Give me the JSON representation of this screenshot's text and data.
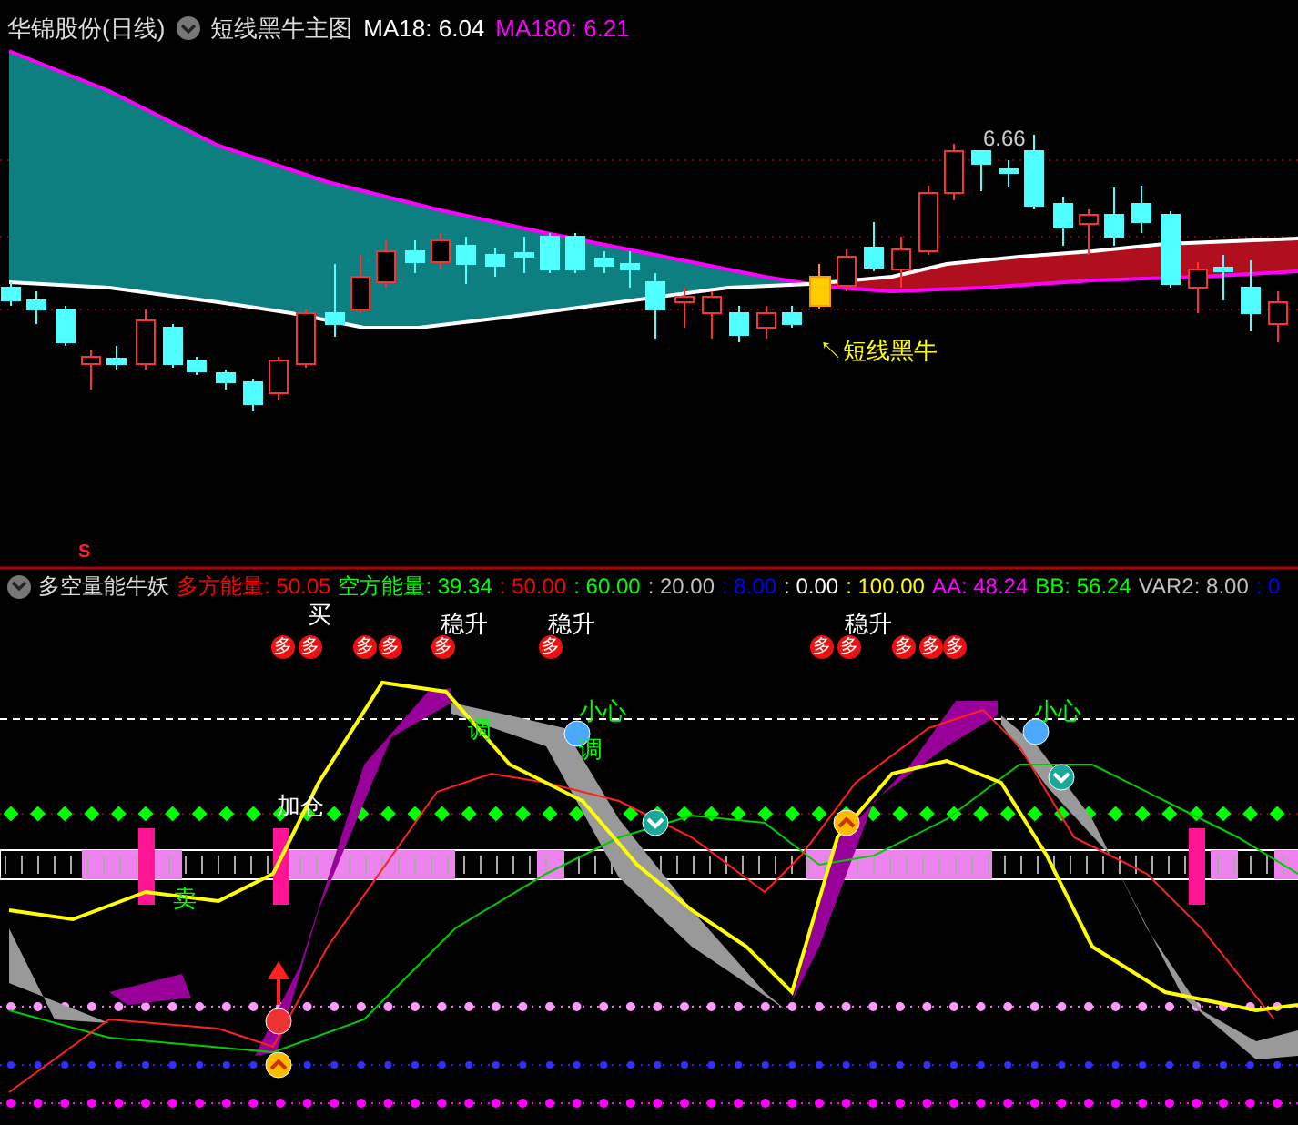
{
  "main_chart": {
    "stock": "华锦股份(日线)",
    "indicator": "短线黑牛主图",
    "readings": [
      {
        "text": "MA18: 6.04",
        "color": "#ffffff"
      },
      {
        "text": "MA180: 6.21",
        "color": "#ff00ff"
      }
    ],
    "peak_label": "6.66",
    "signal_label": "↖短线黑牛"
  },
  "sub_chart": {
    "marker": "S",
    "title": "多空量能牛妖",
    "readings": [
      {
        "text": "多方能量: 50.05",
        "color": "#ff0000"
      },
      {
        "text": "空方能量: 39.34",
        "color": "#00ff00"
      },
      {
        "text": ": 50.00",
        "color": "#ff0000"
      },
      {
        "text": ": 60.00",
        "color": "#00ff00"
      },
      {
        "text": ": 20.00",
        "color": "#c0c0c0"
      },
      {
        "text": ": 8.00",
        "color": "#0000ff"
      },
      {
        "text": ": 0.00",
        "color": "#ffffff"
      },
      {
        "text": ": 100.00",
        "color": "#ffff00"
      },
      {
        "text": "AA: 48.24",
        "color": "#ff00ff"
      },
      {
        "text": "BB: 56.24",
        "color": "#00ff00"
      },
      {
        "text": "VAR2: 8.00",
        "color": "#c0c0c0"
      },
      {
        "text": ": 0",
        "color": "#0000ff"
      }
    ],
    "badges": [
      "多",
      "多",
      "多",
      "多",
      "多",
      "多",
      "多",
      "多",
      "多",
      "多",
      "多"
    ],
    "labels": [
      {
        "text": "买",
        "color": "#ffffff"
      },
      {
        "text": "稳升",
        "color": "#ffffff"
      },
      {
        "text": "稳升",
        "color": "#ffffff"
      },
      {
        "text": "稳升",
        "color": "#ffffff"
      },
      {
        "text": "小心",
        "color": "#00ff00"
      },
      {
        "text": "调",
        "color": "#00ff00"
      },
      {
        "text": "调",
        "color": "#00ff00"
      },
      {
        "text": "小心",
        "color": "#00ff00"
      },
      {
        "text": "加仓",
        "color": "#ffffff"
      },
      {
        "text": "卖",
        "color": "#00ff00"
      }
    ]
  }
}
